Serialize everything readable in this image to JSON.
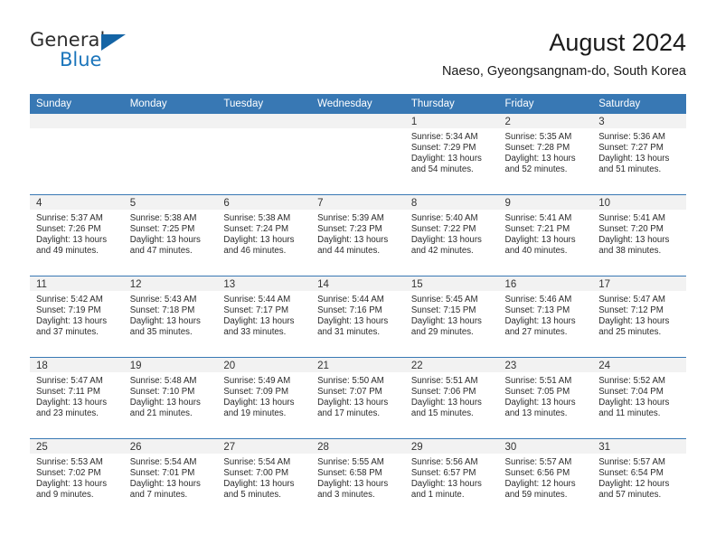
{
  "brand": {
    "name_part1": "General",
    "name_part2": "Blue",
    "triangle_color": "#1464a5",
    "blue_color": "#1b75bb"
  },
  "header": {
    "title": "August 2024",
    "subtitle": "Naeso, Gyeongsangnam-do, South Korea"
  },
  "theme": {
    "header_bg": "#3878b4",
    "daynum_bg": "#f2f2f2",
    "row_divider": "#3878b4"
  },
  "calendar": {
    "weekday_headers": [
      "Sunday",
      "Monday",
      "Tuesday",
      "Wednesday",
      "Thursday",
      "Friday",
      "Saturday"
    ],
    "weeks": [
      [
        {
          "day": "",
          "lines": []
        },
        {
          "day": "",
          "lines": []
        },
        {
          "day": "",
          "lines": []
        },
        {
          "day": "",
          "lines": []
        },
        {
          "day": "1",
          "lines": [
            "Sunrise: 5:34 AM",
            "Sunset: 7:29 PM",
            "Daylight: 13 hours",
            "and 54 minutes."
          ]
        },
        {
          "day": "2",
          "lines": [
            "Sunrise: 5:35 AM",
            "Sunset: 7:28 PM",
            "Daylight: 13 hours",
            "and 52 minutes."
          ]
        },
        {
          "day": "3",
          "lines": [
            "Sunrise: 5:36 AM",
            "Sunset: 7:27 PM",
            "Daylight: 13 hours",
            "and 51 minutes."
          ]
        }
      ],
      [
        {
          "day": "4",
          "lines": [
            "Sunrise: 5:37 AM",
            "Sunset: 7:26 PM",
            "Daylight: 13 hours",
            "and 49 minutes."
          ]
        },
        {
          "day": "5",
          "lines": [
            "Sunrise: 5:38 AM",
            "Sunset: 7:25 PM",
            "Daylight: 13 hours",
            "and 47 minutes."
          ]
        },
        {
          "day": "6",
          "lines": [
            "Sunrise: 5:38 AM",
            "Sunset: 7:24 PM",
            "Daylight: 13 hours",
            "and 46 minutes."
          ]
        },
        {
          "day": "7",
          "lines": [
            "Sunrise: 5:39 AM",
            "Sunset: 7:23 PM",
            "Daylight: 13 hours",
            "and 44 minutes."
          ]
        },
        {
          "day": "8",
          "lines": [
            "Sunrise: 5:40 AM",
            "Sunset: 7:22 PM",
            "Daylight: 13 hours",
            "and 42 minutes."
          ]
        },
        {
          "day": "9",
          "lines": [
            "Sunrise: 5:41 AM",
            "Sunset: 7:21 PM",
            "Daylight: 13 hours",
            "and 40 minutes."
          ]
        },
        {
          "day": "10",
          "lines": [
            "Sunrise: 5:41 AM",
            "Sunset: 7:20 PM",
            "Daylight: 13 hours",
            "and 38 minutes."
          ]
        }
      ],
      [
        {
          "day": "11",
          "lines": [
            "Sunrise: 5:42 AM",
            "Sunset: 7:19 PM",
            "Daylight: 13 hours",
            "and 37 minutes."
          ]
        },
        {
          "day": "12",
          "lines": [
            "Sunrise: 5:43 AM",
            "Sunset: 7:18 PM",
            "Daylight: 13 hours",
            "and 35 minutes."
          ]
        },
        {
          "day": "13",
          "lines": [
            "Sunrise: 5:44 AM",
            "Sunset: 7:17 PM",
            "Daylight: 13 hours",
            "and 33 minutes."
          ]
        },
        {
          "day": "14",
          "lines": [
            "Sunrise: 5:44 AM",
            "Sunset: 7:16 PM",
            "Daylight: 13 hours",
            "and 31 minutes."
          ]
        },
        {
          "day": "15",
          "lines": [
            "Sunrise: 5:45 AM",
            "Sunset: 7:15 PM",
            "Daylight: 13 hours",
            "and 29 minutes."
          ]
        },
        {
          "day": "16",
          "lines": [
            "Sunrise: 5:46 AM",
            "Sunset: 7:13 PM",
            "Daylight: 13 hours",
            "and 27 minutes."
          ]
        },
        {
          "day": "17",
          "lines": [
            "Sunrise: 5:47 AM",
            "Sunset: 7:12 PM",
            "Daylight: 13 hours",
            "and 25 minutes."
          ]
        }
      ],
      [
        {
          "day": "18",
          "lines": [
            "Sunrise: 5:47 AM",
            "Sunset: 7:11 PM",
            "Daylight: 13 hours",
            "and 23 minutes."
          ]
        },
        {
          "day": "19",
          "lines": [
            "Sunrise: 5:48 AM",
            "Sunset: 7:10 PM",
            "Daylight: 13 hours",
            "and 21 minutes."
          ]
        },
        {
          "day": "20",
          "lines": [
            "Sunrise: 5:49 AM",
            "Sunset: 7:09 PM",
            "Daylight: 13 hours",
            "and 19 minutes."
          ]
        },
        {
          "day": "21",
          "lines": [
            "Sunrise: 5:50 AM",
            "Sunset: 7:07 PM",
            "Daylight: 13 hours",
            "and 17 minutes."
          ]
        },
        {
          "day": "22",
          "lines": [
            "Sunrise: 5:51 AM",
            "Sunset: 7:06 PM",
            "Daylight: 13 hours",
            "and 15 minutes."
          ]
        },
        {
          "day": "23",
          "lines": [
            "Sunrise: 5:51 AM",
            "Sunset: 7:05 PM",
            "Daylight: 13 hours",
            "and 13 minutes."
          ]
        },
        {
          "day": "24",
          "lines": [
            "Sunrise: 5:52 AM",
            "Sunset: 7:04 PM",
            "Daylight: 13 hours",
            "and 11 minutes."
          ]
        }
      ],
      [
        {
          "day": "25",
          "lines": [
            "Sunrise: 5:53 AM",
            "Sunset: 7:02 PM",
            "Daylight: 13 hours",
            "and 9 minutes."
          ]
        },
        {
          "day": "26",
          "lines": [
            "Sunrise: 5:54 AM",
            "Sunset: 7:01 PM",
            "Daylight: 13 hours",
            "and 7 minutes."
          ]
        },
        {
          "day": "27",
          "lines": [
            "Sunrise: 5:54 AM",
            "Sunset: 7:00 PM",
            "Daylight: 13 hours",
            "and 5 minutes."
          ]
        },
        {
          "day": "28",
          "lines": [
            "Sunrise: 5:55 AM",
            "Sunset: 6:58 PM",
            "Daylight: 13 hours",
            "and 3 minutes."
          ]
        },
        {
          "day": "29",
          "lines": [
            "Sunrise: 5:56 AM",
            "Sunset: 6:57 PM",
            "Daylight: 13 hours",
            "and 1 minute."
          ]
        },
        {
          "day": "30",
          "lines": [
            "Sunrise: 5:57 AM",
            "Sunset: 6:56 PM",
            "Daylight: 12 hours",
            "and 59 minutes."
          ]
        },
        {
          "day": "31",
          "lines": [
            "Sunrise: 5:57 AM",
            "Sunset: 6:54 PM",
            "Daylight: 12 hours",
            "and 57 minutes."
          ]
        }
      ]
    ]
  }
}
